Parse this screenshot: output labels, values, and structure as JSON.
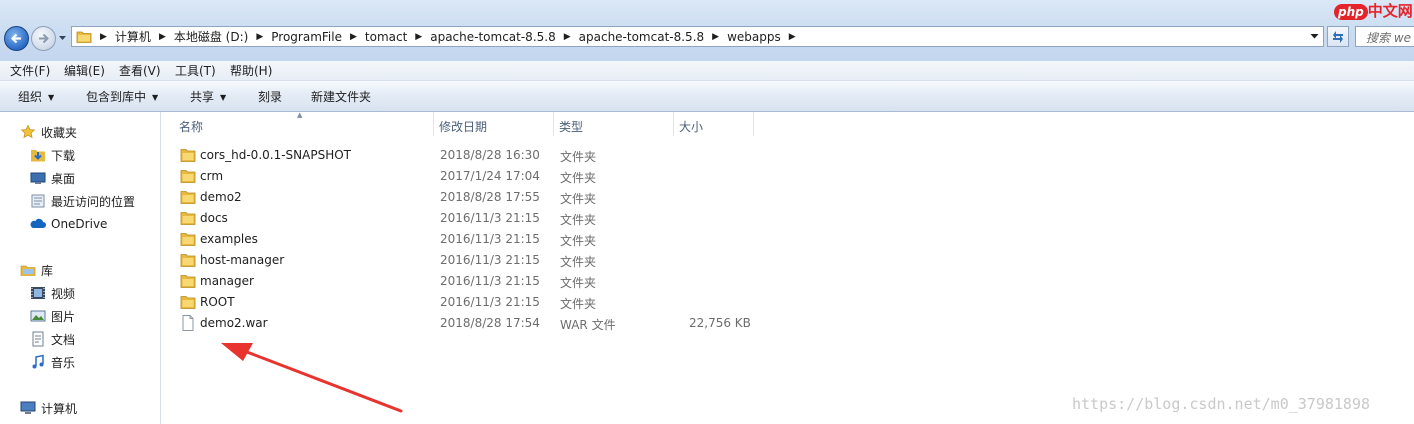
{
  "address": {
    "breadcrumbs": [
      "计算机",
      "本地磁盘 (D:)",
      "ProgramFile",
      "tomact",
      "apache-tomcat-8.5.8",
      "apache-tomcat-8.5.8",
      "webapps"
    ],
    "search_placeholder": "搜索 we"
  },
  "watermark_logo": {
    "php": "php",
    "cn": "中文网"
  },
  "menu": [
    "文件(F)",
    "编辑(E)",
    "查看(V)",
    "工具(T)",
    "帮助(H)"
  ],
  "toolbar": {
    "organize": "组织",
    "include_library": "包含到库中",
    "share": "共享",
    "burn": "刻录",
    "new_folder": "新建文件夹"
  },
  "nav": {
    "favorites": "收藏夹",
    "downloads": "下载",
    "desktop": "桌面",
    "recent": "最近访问的位置",
    "onedrive": "OneDrive",
    "libraries": "库",
    "videos": "视频",
    "pictures": "图片",
    "documents": "文档",
    "music": "音乐",
    "computer": "计算机"
  },
  "columns": {
    "name": "名称",
    "modified": "修改日期",
    "type": "类型",
    "size": "大小"
  },
  "files": [
    {
      "name": "cors_hd-0.0.1-SNAPSHOT",
      "modified": "2018/8/28 16:30",
      "type": "文件夹",
      "size": "",
      "kind": "folder"
    },
    {
      "name": "crm",
      "modified": "2017/1/24 17:04",
      "type": "文件夹",
      "size": "",
      "kind": "folder"
    },
    {
      "name": "demo2",
      "modified": "2018/8/28 17:55",
      "type": "文件夹",
      "size": "",
      "kind": "folder"
    },
    {
      "name": "docs",
      "modified": "2016/11/3 21:15",
      "type": "文件夹",
      "size": "",
      "kind": "folder"
    },
    {
      "name": "examples",
      "modified": "2016/11/3 21:15",
      "type": "文件夹",
      "size": "",
      "kind": "folder"
    },
    {
      "name": "host-manager",
      "modified": "2016/11/3 21:15",
      "type": "文件夹",
      "size": "",
      "kind": "folder"
    },
    {
      "name": "manager",
      "modified": "2016/11/3 21:15",
      "type": "文件夹",
      "size": "",
      "kind": "folder"
    },
    {
      "name": "ROOT",
      "modified": "2016/11/3 21:15",
      "type": "文件夹",
      "size": "",
      "kind": "folder"
    },
    {
      "name": "demo2.war",
      "modified": "2018/8/28 17:54",
      "type": "WAR 文件",
      "size": "22,756 KB",
      "kind": "file"
    }
  ],
  "watermark_text": "https://blog.csdn.net/m0_37981898",
  "colors": {
    "annotation_arrow": "#e8332f",
    "folder": "#e7b93e",
    "accent": "#2a6bc7"
  }
}
